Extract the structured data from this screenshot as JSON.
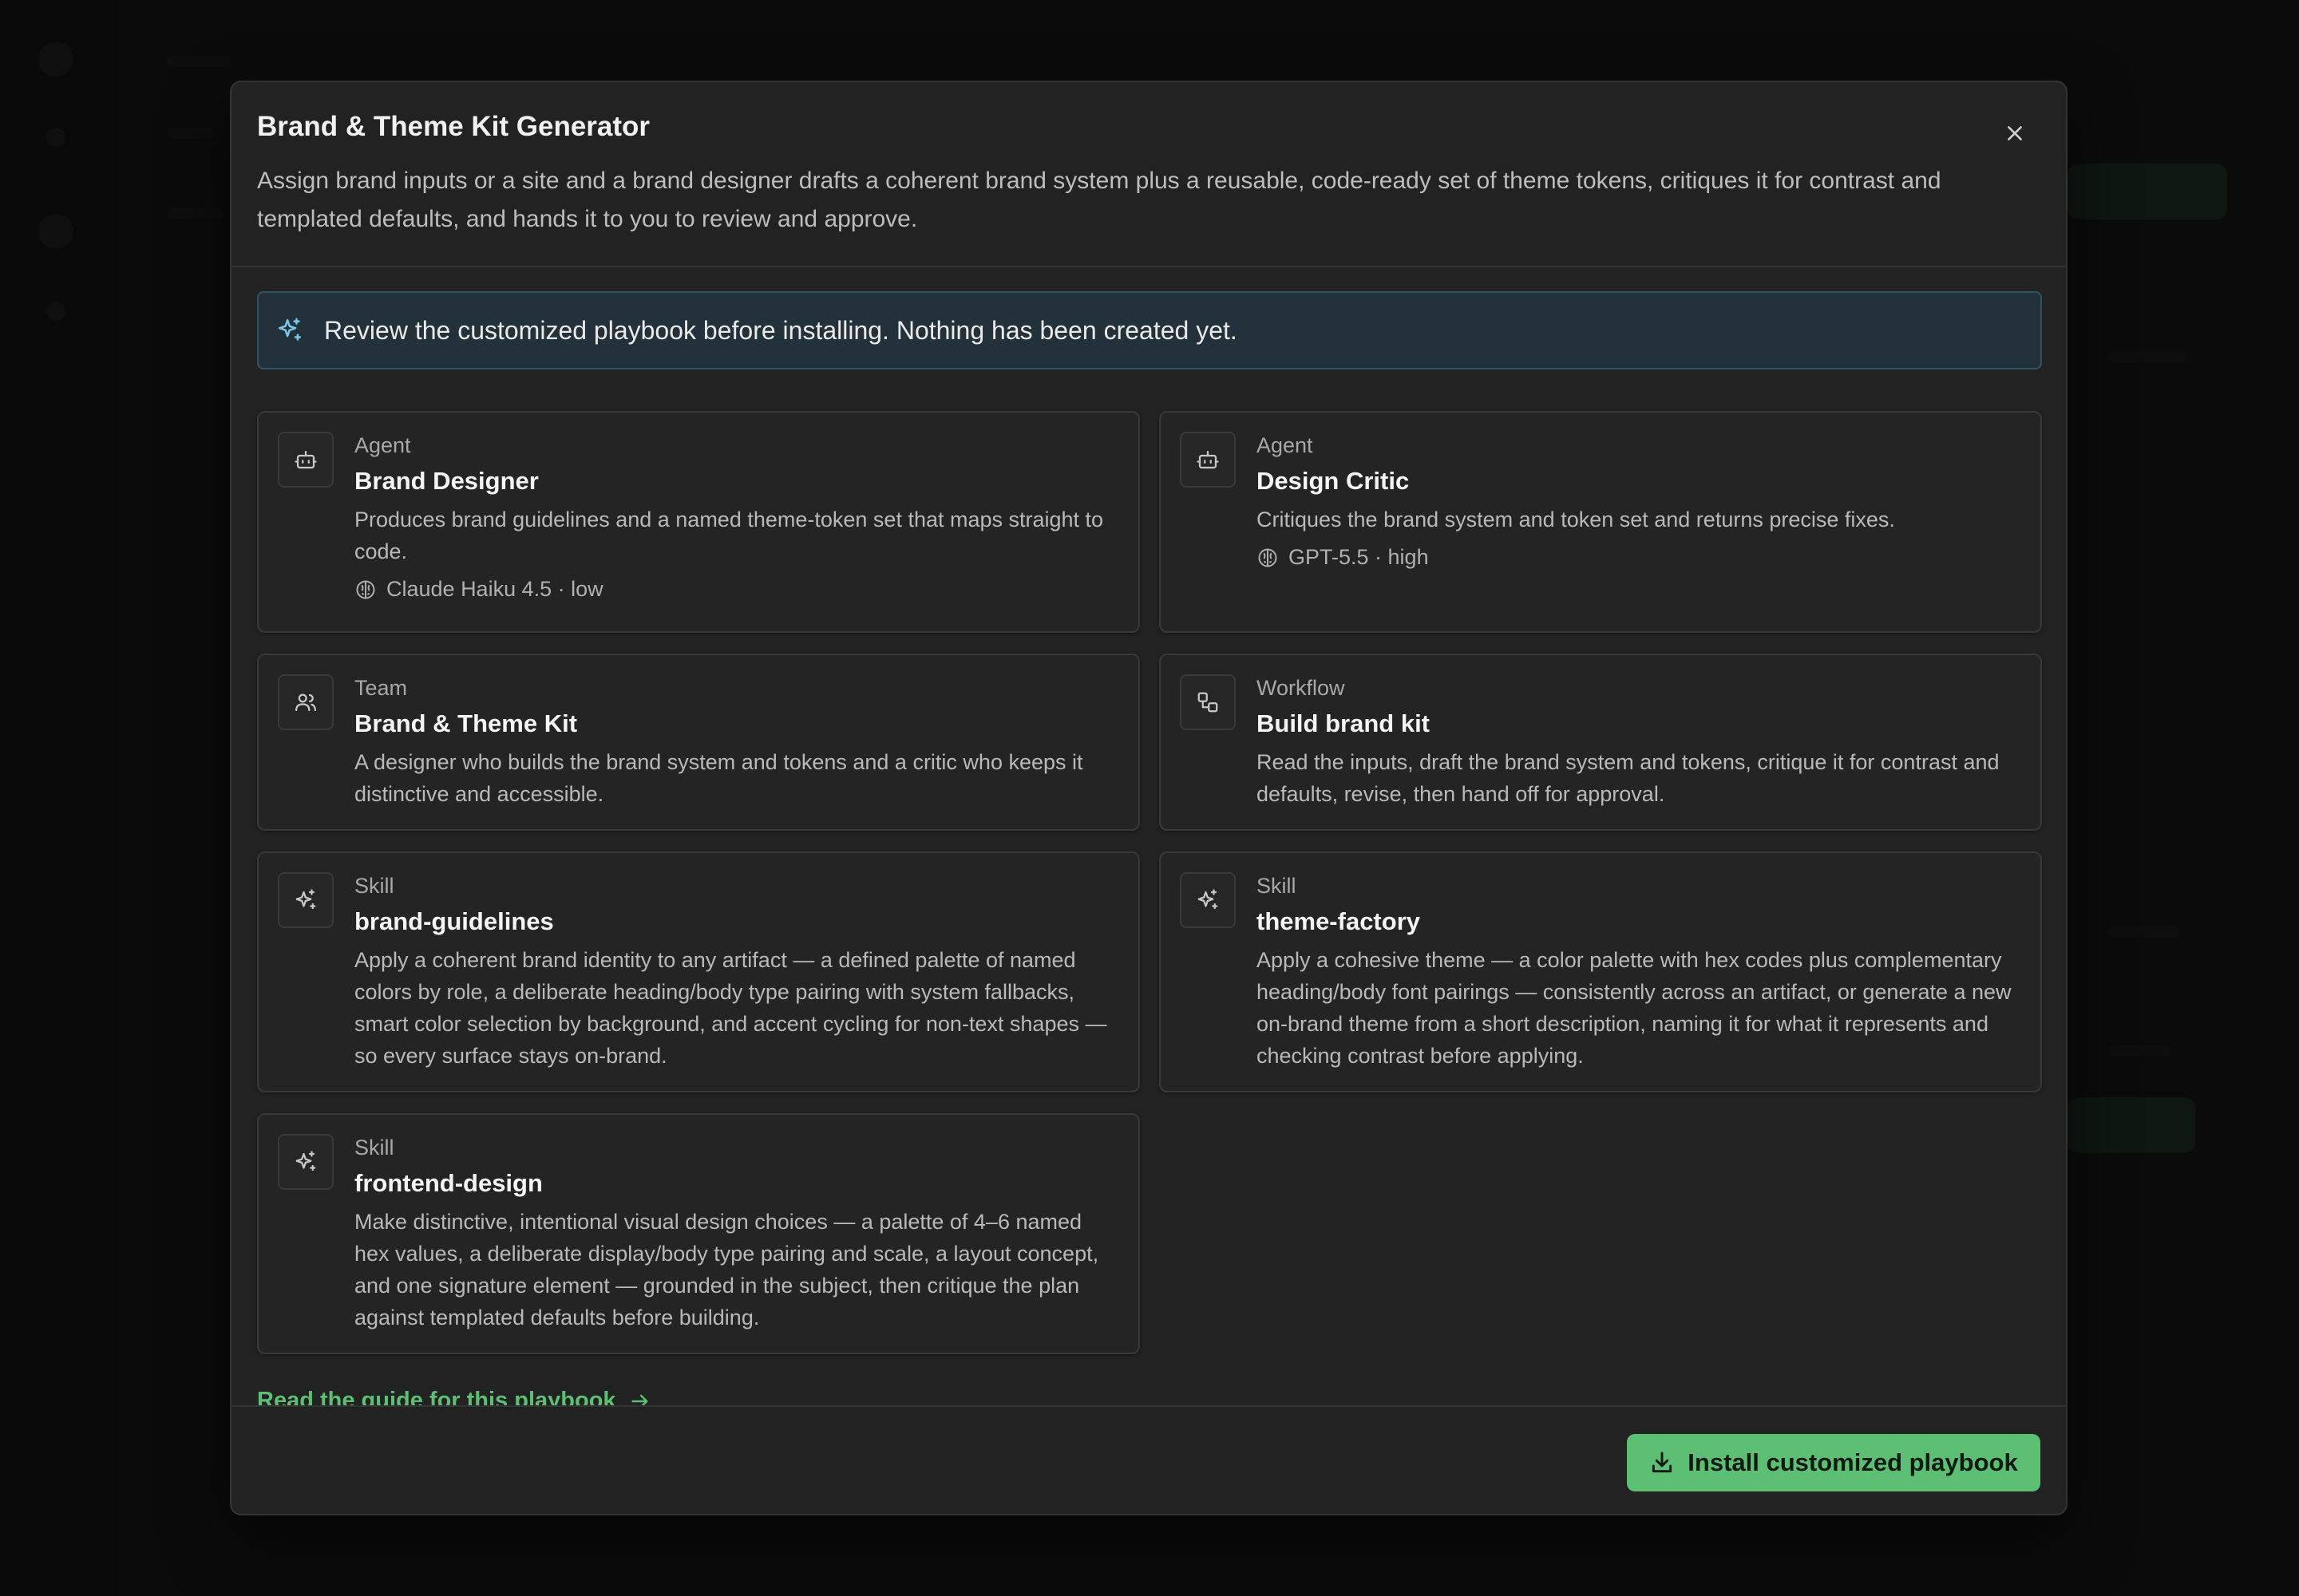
{
  "modal": {
    "title": "Brand & Theme Kit Generator",
    "description": "Assign brand inputs or a site and a brand designer drafts a coherent brand system plus a reusable, code-ready set of theme tokens, critiques it for contrast and templated defaults, and hands it to you to review and approve.",
    "close_icon": "close-icon"
  },
  "notice": {
    "icon": "sparkles-icon",
    "text": "Review the customized playbook before installing. Nothing has been created yet."
  },
  "cards": [
    {
      "type": "Agent",
      "name": "Brand Designer",
      "description": "Produces brand guidelines and a named theme-token set that maps straight to code.",
      "model": "Claude Haiku 4.5 · low",
      "icon": "bot-icon"
    },
    {
      "type": "Agent",
      "name": "Design Critic",
      "description": "Critiques the brand system and token set and returns precise fixes.",
      "model": "GPT-5.5 · high",
      "icon": "bot-icon"
    },
    {
      "type": "Team",
      "name": "Brand & Theme Kit",
      "description": "A designer who builds the brand system and tokens and a critic who keeps it distinctive and accessible.",
      "icon": "users-icon"
    },
    {
      "type": "Workflow",
      "name": "Build brand kit",
      "description": "Read the inputs, draft the brand system and tokens, critique it for contrast and defaults, revise, then hand off for approval.",
      "icon": "workflow-icon"
    },
    {
      "type": "Skill",
      "name": "brand-guidelines",
      "description": "Apply a coherent brand identity to any artifact — a defined palette of named colors by role, a deliberate heading/body type pairing with system fallbacks, smart color selection by background, and accent cycling for non-text shapes — so every surface stays on-brand.",
      "icon": "sparkles-icon"
    },
    {
      "type": "Skill",
      "name": "theme-factory",
      "description": "Apply a cohesive theme — a color palette with hex codes plus complementary heading/body font pairings — consistently across an artifact, or generate a new on-brand theme from a short description, naming it for what it represents and checking contrast before applying.",
      "icon": "sparkles-icon"
    },
    {
      "type": "Skill",
      "name": "frontend-design",
      "description": "Make distinctive, intentional visual design choices — a palette of 4–6 named hex values, a deliberate display/body type pairing and scale, a layout concept, and one signature element — grounded in the subject, then critique the plan against templated defaults before building.",
      "icon": "sparkles-icon"
    }
  ],
  "guide_link": "Read the guide for this playbook",
  "install_button": "Install customized playbook",
  "colors": {
    "accent": "#5cbf73",
    "notice_bg": "#22313a",
    "notice_border": "#2d5566",
    "modal_bg": "#222222"
  }
}
